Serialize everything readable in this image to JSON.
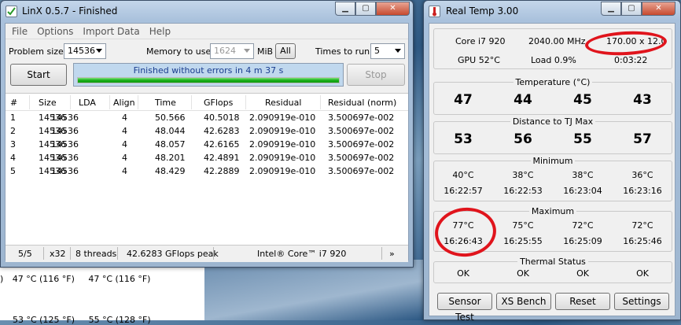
{
  "desktop": {
    "row1": {
      "a": ")",
      "b": "47 °C  (116 °F)",
      "c": "47 °C  (116 °F)"
    },
    "row2": {
      "b": "53 °C  (125 °F)",
      "c": "55 °C  (128 °F)"
    }
  },
  "linx": {
    "title": "LinX 0.5.7 - Finished",
    "menu": [
      "File",
      "Options",
      "Import Data",
      "Help"
    ],
    "problem_size_label": "Problem size:",
    "problem_size": "14536",
    "memory_label": "Memory to use:",
    "memory_value": "1624",
    "memory_unit": "MiB",
    "all_label": "All",
    "times_label": "Times to run:",
    "times_value": "5",
    "start_label": "Start",
    "stop_label": "Stop",
    "progress_text": "Finished without errors in 4 m 37 s",
    "progress_fraction": 1.0,
    "columns": [
      "#",
      "Size",
      "LDA",
      "Align",
      "Time",
      "GFlops",
      "Residual",
      "Residual (norm)"
    ],
    "rows": [
      [
        "1",
        "14536",
        "14536",
        "4",
        "50.566",
        "40.5018",
        "2.090919e-010",
        "3.500697e-002"
      ],
      [
        "2",
        "14536",
        "14536",
        "4",
        "48.044",
        "42.6283",
        "2.090919e-010",
        "3.500697e-002"
      ],
      [
        "3",
        "14536",
        "14536",
        "4",
        "48.057",
        "42.6165",
        "2.090919e-010",
        "3.500697e-002"
      ],
      [
        "4",
        "14536",
        "14536",
        "4",
        "48.201",
        "42.4891",
        "2.090919e-010",
        "3.500697e-002"
      ],
      [
        "5",
        "14536",
        "14536",
        "4",
        "48.429",
        "42.2889",
        "2.090919e-010",
        "3.500697e-002"
      ]
    ],
    "status": {
      "progress": "5/5",
      "arch": "x32",
      "threads": "8 threads",
      "peak": "42.6283 GFlops peak",
      "cpu": "Intel® Core™ i7 920",
      "more": "»"
    }
  },
  "realtemp": {
    "title": "Real Temp 3.00",
    "cpu_name": "Core i7 920",
    "frequency": "2040.00 MHz",
    "multiplier": "170.00 x 12.0",
    "gpu": "GPU  52°C",
    "load": "Load  0.9%",
    "elapsed": "0:03:22",
    "temperature": {
      "title": "Temperature (°C)",
      "values": [
        "47",
        "44",
        "45",
        "43"
      ]
    },
    "distance": {
      "title": "Distance to TJ Max",
      "values": [
        "53",
        "56",
        "55",
        "57"
      ]
    },
    "minimum": {
      "title": "Minimum",
      "temps": [
        "40°C",
        "38°C",
        "38°C",
        "36°C"
      ],
      "times": [
        "16:22:57",
        "16:22:53",
        "16:23:04",
        "16:23:16"
      ]
    },
    "maximum": {
      "title": "Maximum",
      "temps": [
        "77°C",
        "75°C",
        "72°C",
        "72°C"
      ],
      "times": [
        "16:26:43",
        "16:25:55",
        "16:25:09",
        "16:25:46"
      ]
    },
    "thermal": {
      "title": "Thermal Status",
      "values": [
        "OK",
        "OK",
        "OK",
        "OK"
      ]
    },
    "buttons": {
      "sensor_test": "Sensor Test",
      "xs_bench": "XS Bench",
      "reset": "Reset",
      "settings": "Settings"
    }
  },
  "icons": [
    "checkbox-icon",
    "thermometer-icon",
    "minimize-icon",
    "maximize-icon",
    "close-icon",
    "dropdown-arrow-icon"
  ],
  "colors": {
    "annotation": "#e0141c",
    "progress": "#18b018",
    "progress_text": "#1a3d8f"
  }
}
